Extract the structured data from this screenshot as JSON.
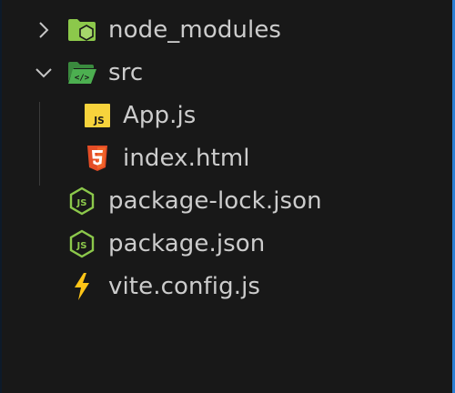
{
  "explorer": {
    "items": [
      {
        "label": "node_modules",
        "kind": "folder",
        "state": "collapsed",
        "icon": "nodejs-folder-icon",
        "level": 0
      },
      {
        "label": "src",
        "kind": "folder",
        "state": "expanded",
        "icon": "src-folder-open-icon",
        "level": 0
      },
      {
        "label": "App.js",
        "kind": "file",
        "icon": "javascript-file-icon",
        "level": 1
      },
      {
        "label": "index.html",
        "kind": "file",
        "icon": "html5-file-icon",
        "level": 1
      },
      {
        "label": "package-lock.json",
        "kind": "file",
        "icon": "nodejs-json-file-icon",
        "level": 0
      },
      {
        "label": "package.json",
        "kind": "file",
        "icon": "nodejs-json-file-icon",
        "level": 0
      },
      {
        "label": "vite.config.js",
        "kind": "file",
        "icon": "vite-lightning-icon",
        "level": 0
      }
    ],
    "js_badge": "JS",
    "colors": {
      "background": "#181818",
      "text": "#cccccc",
      "focus_border": "#2b7fd4",
      "node_green": "#8cc84b",
      "src_folder_green": "#4caf50",
      "js_yellow": "#f7d33c",
      "html_orange": "#e44d26",
      "vite_yellow": "#ffc517"
    }
  }
}
